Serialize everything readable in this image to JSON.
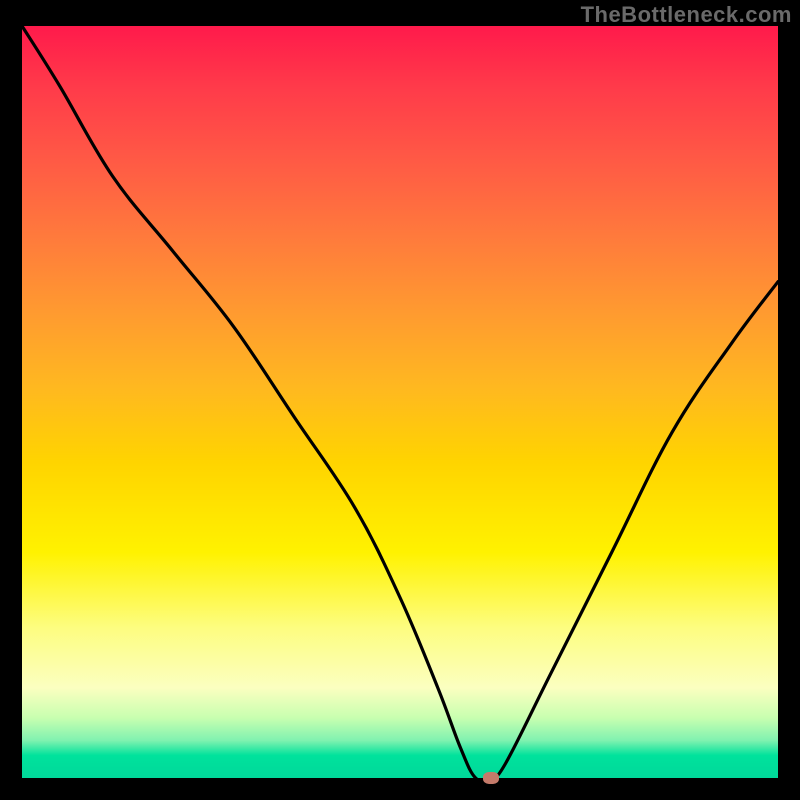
{
  "watermark": "TheBottleneck.com",
  "chart_data": {
    "type": "line",
    "title": "",
    "xlabel": "",
    "ylabel": "",
    "xlim": [
      0,
      100
    ],
    "ylim": [
      0,
      100
    ],
    "grid": false,
    "legend": false,
    "series": [
      {
        "name": "bottleneck-curve",
        "x": [
          0,
          5,
          12,
          20,
          28,
          36,
          44,
          50,
          55,
          58,
          60,
          62,
          64,
          70,
          78,
          86,
          94,
          100
        ],
        "y": [
          100,
          92,
          80,
          70,
          60,
          48,
          36,
          24,
          12,
          4,
          0,
          0,
          2,
          14,
          30,
          46,
          58,
          66
        ]
      }
    ],
    "markers": [
      {
        "name": "bottleneck-point",
        "x": 62,
        "y": 0,
        "color": "#c47a6a"
      }
    ],
    "background_gradient": {
      "top": "#ff1a4b",
      "mid": "#ffd400",
      "bottom": "#00d89a"
    }
  }
}
